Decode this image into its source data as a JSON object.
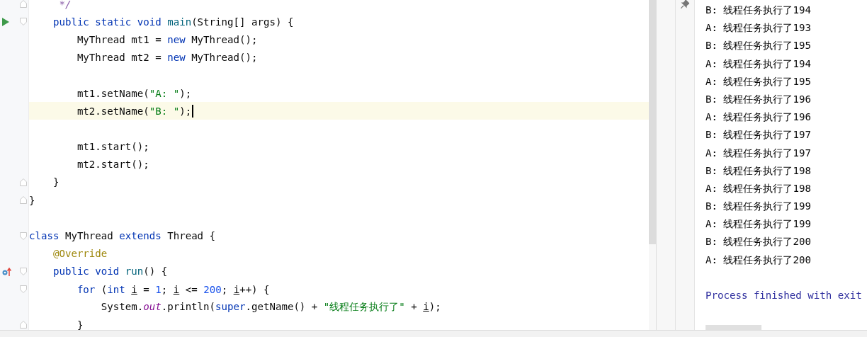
{
  "editor": {
    "lines": [
      {
        "kind": "code",
        "gutter_icons": [
          {
            "kind": "fold-end"
          }
        ],
        "tokens": [
          {
            "text": "     */",
            "kind": "doc-comment"
          }
        ]
      },
      {
        "kind": "code",
        "gutter_icons": [
          {
            "kind": "run"
          },
          {
            "kind": "fold-start"
          }
        ],
        "tokens": [
          {
            "text": "    public static void ",
            "kind": "keyword"
          },
          {
            "text": "main",
            "kind": "method"
          },
          {
            "text": "(String[] args) {",
            "kind": "plain"
          }
        ]
      },
      {
        "kind": "code",
        "tokens": [
          {
            "text": "        MyThread mt1 = ",
            "kind": "plain"
          },
          {
            "text": "new",
            "kind": "keyword"
          },
          {
            "text": " MyThread();",
            "kind": "plain"
          }
        ]
      },
      {
        "kind": "code",
        "tokens": [
          {
            "text": "        MyThread mt2 = ",
            "kind": "plain"
          },
          {
            "text": "new",
            "kind": "keyword"
          },
          {
            "text": " MyThread();",
            "kind": "plain"
          }
        ]
      },
      {
        "kind": "blank"
      },
      {
        "kind": "code",
        "tokens": [
          {
            "text": "        mt1.setName(",
            "kind": "plain"
          },
          {
            "text": "\"A: \"",
            "kind": "string"
          },
          {
            "text": ");",
            "kind": "plain"
          }
        ]
      },
      {
        "kind": "code",
        "current": true,
        "tokens": [
          {
            "text": "        mt2.setName(",
            "kind": "plain"
          },
          {
            "text": "\"B: \"",
            "kind": "string"
          },
          {
            "text": ");",
            "kind": "plain"
          }
        ]
      },
      {
        "kind": "blank"
      },
      {
        "kind": "code",
        "tokens": [
          {
            "text": "        mt1.start();",
            "kind": "plain"
          }
        ]
      },
      {
        "kind": "code",
        "tokens": [
          {
            "text": "        mt2.start();",
            "kind": "plain"
          }
        ]
      },
      {
        "kind": "code",
        "gutter_icons": [
          {
            "kind": "fold-end"
          }
        ],
        "tokens": [
          {
            "text": "    }",
            "kind": "plain"
          }
        ]
      },
      {
        "kind": "code",
        "gutter_icons": [
          {
            "kind": "fold-end"
          }
        ],
        "tokens": [
          {
            "text": "}",
            "kind": "plain"
          }
        ]
      },
      {
        "kind": "blank"
      },
      {
        "kind": "code",
        "gutter_icons": [
          {
            "kind": "fold-start"
          }
        ],
        "tokens": [
          {
            "text": "class",
            "kind": "keyword"
          },
          {
            "text": " MyThread ",
            "kind": "plain"
          },
          {
            "text": "extends",
            "kind": "keyword"
          },
          {
            "text": " Thread {",
            "kind": "plain"
          }
        ]
      },
      {
        "kind": "code",
        "tokens": [
          {
            "text": "    @Override",
            "kind": "annotation"
          }
        ]
      },
      {
        "kind": "code",
        "gutter_icons": [
          {
            "kind": "override"
          },
          {
            "kind": "fold-start"
          }
        ],
        "tokens": [
          {
            "text": "    public void ",
            "kind": "keyword"
          },
          {
            "text": "run",
            "kind": "method"
          },
          {
            "text": "() {",
            "kind": "plain"
          }
        ]
      },
      {
        "kind": "code",
        "gutter_icons": [
          {
            "kind": "fold-start"
          }
        ],
        "tokens": [
          {
            "text": "        for",
            "kind": "keyword"
          },
          {
            "text": " (",
            "kind": "plain"
          },
          {
            "text": "int ",
            "kind": "keyword"
          },
          {
            "text": "i",
            "kind": "mutated-var"
          },
          {
            "text": " = ",
            "kind": "plain"
          },
          {
            "text": "1",
            "kind": "number"
          },
          {
            "text": "; ",
            "kind": "plain"
          },
          {
            "text": "i",
            "kind": "mutated-var"
          },
          {
            "text": " <= ",
            "kind": "plain"
          },
          {
            "text": "200",
            "kind": "number"
          },
          {
            "text": "; ",
            "kind": "plain"
          },
          {
            "text": "i",
            "kind": "mutated-var"
          },
          {
            "text": "++) {",
            "kind": "plain"
          }
        ]
      },
      {
        "kind": "code",
        "tokens": [
          {
            "text": "            System.",
            "kind": "plain"
          },
          {
            "text": "out",
            "kind": "static-field"
          },
          {
            "text": ".println(",
            "kind": "plain"
          },
          {
            "text": "super",
            "kind": "keyword"
          },
          {
            "text": ".getName() + ",
            "kind": "plain"
          },
          {
            "text": "\"线程任务执行了\"",
            "kind": "string"
          },
          {
            "text": " + ",
            "kind": "plain"
          },
          {
            "text": "i",
            "kind": "mutated-var"
          },
          {
            "text": ");",
            "kind": "plain"
          }
        ]
      },
      {
        "kind": "code",
        "gutter_icons": [
          {
            "kind": "fold-end"
          }
        ],
        "tokens": [
          {
            "text": "        }",
            "kind": "plain"
          }
        ]
      }
    ]
  },
  "console": {
    "lines": [
      {
        "text": "B: 线程任务执行了194",
        "kind": "output"
      },
      {
        "text": "A: 线程任务执行了193",
        "kind": "output"
      },
      {
        "text": "B: 线程任务执行了195",
        "kind": "output"
      },
      {
        "text": "A: 线程任务执行了194",
        "kind": "output"
      },
      {
        "text": "A: 线程任务执行了195",
        "kind": "output"
      },
      {
        "text": "B: 线程任务执行了196",
        "kind": "output"
      },
      {
        "text": "A: 线程任务执行了196",
        "kind": "output"
      },
      {
        "text": "B: 线程任务执行了197",
        "kind": "output"
      },
      {
        "text": "A: 线程任务执行了197",
        "kind": "output"
      },
      {
        "text": "B: 线程任务执行了198",
        "kind": "output"
      },
      {
        "text": "A: 线程任务执行了198",
        "kind": "output"
      },
      {
        "text": "B: 线程任务执行了199",
        "kind": "output"
      },
      {
        "text": "A: 线程任务执行了199",
        "kind": "output"
      },
      {
        "text": "B: 线程任务执行了200",
        "kind": "output"
      },
      {
        "text": "A: 线程任务执行了200",
        "kind": "output"
      },
      {
        "text": "Process finished with exit",
        "kind": "system"
      }
    ]
  }
}
